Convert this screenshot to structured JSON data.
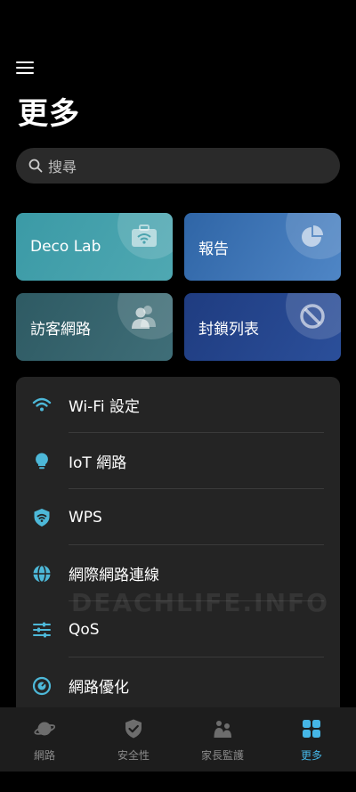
{
  "header": {
    "title": "更多",
    "menu_icon": "hamburger-icon"
  },
  "search": {
    "placeholder": "搜尋",
    "icon": "search-icon"
  },
  "tiles": [
    {
      "label": "Deco Lab",
      "icon": "toolbox-wifi-icon",
      "color": "#45a1ab"
    },
    {
      "label": "報告",
      "icon": "pie-chart-icon",
      "color": "#3f76b6"
    },
    {
      "label": "訪客網路",
      "icon": "guests-icon",
      "color": "#356570"
    },
    {
      "label": "封鎖列表",
      "icon": "block-icon",
      "color": "#26468d"
    }
  ],
  "list": [
    {
      "label": "Wi-Fi 設定",
      "icon": "wifi-icon"
    },
    {
      "label": "IoT 網路",
      "icon": "lightbulb-icon"
    },
    {
      "label": "WPS",
      "icon": "wps-shield-icon"
    },
    {
      "label": "網際網路連線",
      "icon": "globe-icon"
    },
    {
      "label": "QoS",
      "icon": "sliders-icon"
    },
    {
      "label": "網路優化",
      "icon": "optimize-icon"
    }
  ],
  "watermark": "DEACHLIFE.INFO",
  "tabbar": [
    {
      "label": "網路",
      "icon": "planet-icon",
      "active": false
    },
    {
      "label": "安全性",
      "icon": "shield-check-icon",
      "active": false
    },
    {
      "label": "家長監護",
      "icon": "family-icon",
      "active": false
    },
    {
      "label": "更多",
      "icon": "grid-icon",
      "active": true
    }
  ],
  "colors": {
    "accent": "#45b6e6",
    "icon_teal": "#4db8d8",
    "background": "#000000",
    "card": "#242424"
  }
}
